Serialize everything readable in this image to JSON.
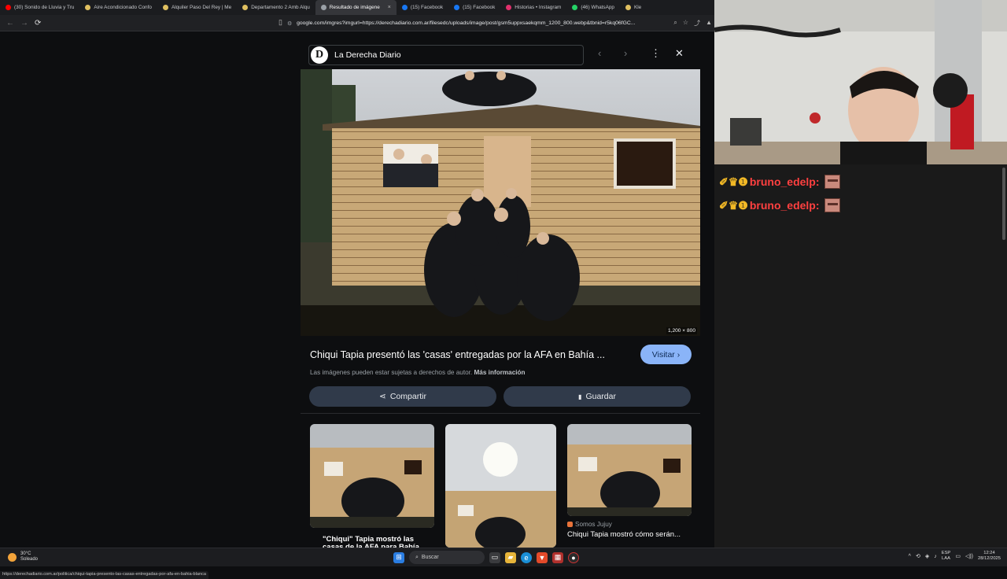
{
  "tabs": [
    {
      "label": "(30) Sonido de Lluvia y Tru",
      "color": "#ff0000",
      "active": false
    },
    {
      "label": "Aire Acondicionado Confo",
      "color": "#e0c060",
      "active": false
    },
    {
      "label": "Alquiler Paso Del Rey | Me",
      "color": "#e0c060",
      "active": false
    },
    {
      "label": "Departamento 2 Amb Alqu",
      "color": "#e0c060",
      "active": false
    },
    {
      "label": "Resultado de imágene",
      "color": "#9aa0a6",
      "active": true
    },
    {
      "label": "(15) Facebook",
      "color": "#1877f2",
      "active": false
    },
    {
      "label": "(15) Facebook",
      "color": "#1877f2",
      "active": false
    },
    {
      "label": "Historias • Instagram",
      "color": "#e1306c",
      "active": false
    },
    {
      "label": "(46) WhatsApp",
      "color": "#25d366",
      "active": false
    },
    {
      "label": "Kle",
      "color": "#e0c060",
      "active": false
    }
  ],
  "tab_close": "×",
  "nav": {
    "back": "←",
    "forward": "→",
    "reload": "⟳"
  },
  "address": {
    "url": "google.com/imgres?imgurl=https://derechadiario.com.ar/filesedc/uploads/image/post/gsm5uppxsaekqmm_1200_800.webp&tbnid=r5kq06fGC...",
    "icons": [
      "⌕",
      "☆",
      "⤴",
      "▲"
    ]
  },
  "viewer": {
    "source_logo": "D",
    "source_name": "La Derecha Diario",
    "prev": "‹",
    "next": "›",
    "more": "⋮",
    "close": "✕",
    "image_dims": "1,200 × 800",
    "title": "Chiqui Tapia presentó las 'casas' entregadas por la AFA en Bahía ...",
    "visit_label": "Visitar",
    "visit_arrow": "›",
    "rights_note": "Las imágenes pueden estar sujetas a derechos de autor.",
    "more_info": "Más información",
    "share_label": "Compartir",
    "save_label": "Guardar",
    "share_icon": "⋖",
    "save_icon": "▮"
  },
  "related": [
    {
      "caption_line1": "\"Chiqui\" Tapia mostró las",
      "caption_line2": "casas de la AFA para Bahía",
      "source": ""
    },
    {
      "caption_line1": "",
      "caption_line2": "",
      "source": ""
    },
    {
      "caption_line1": "Chiqui Tapia mostró cómo serán...",
      "caption_line2": "",
      "source": "Somos Jujuy"
    }
  ],
  "status_url": "https://derechadiario.com.ar/politica/chiqui-tapia-presento-las-casas-entregadas-por-afa-en-bahia-blanca",
  "chat": [
    {
      "badges": "✐♛❶",
      "username": "bruno_edelp:"
    },
    {
      "badges": "✐♛❶",
      "username": "bruno_edelp:"
    }
  ],
  "taskbar": {
    "weather_temp": "30°C",
    "weather_desc": "Soleado",
    "search_placeholder": "Buscar",
    "lang_top": "ESP",
    "lang_bottom": "LAA",
    "time": "12:24",
    "date": "28/12/2025",
    "tray_arrow": "^"
  }
}
